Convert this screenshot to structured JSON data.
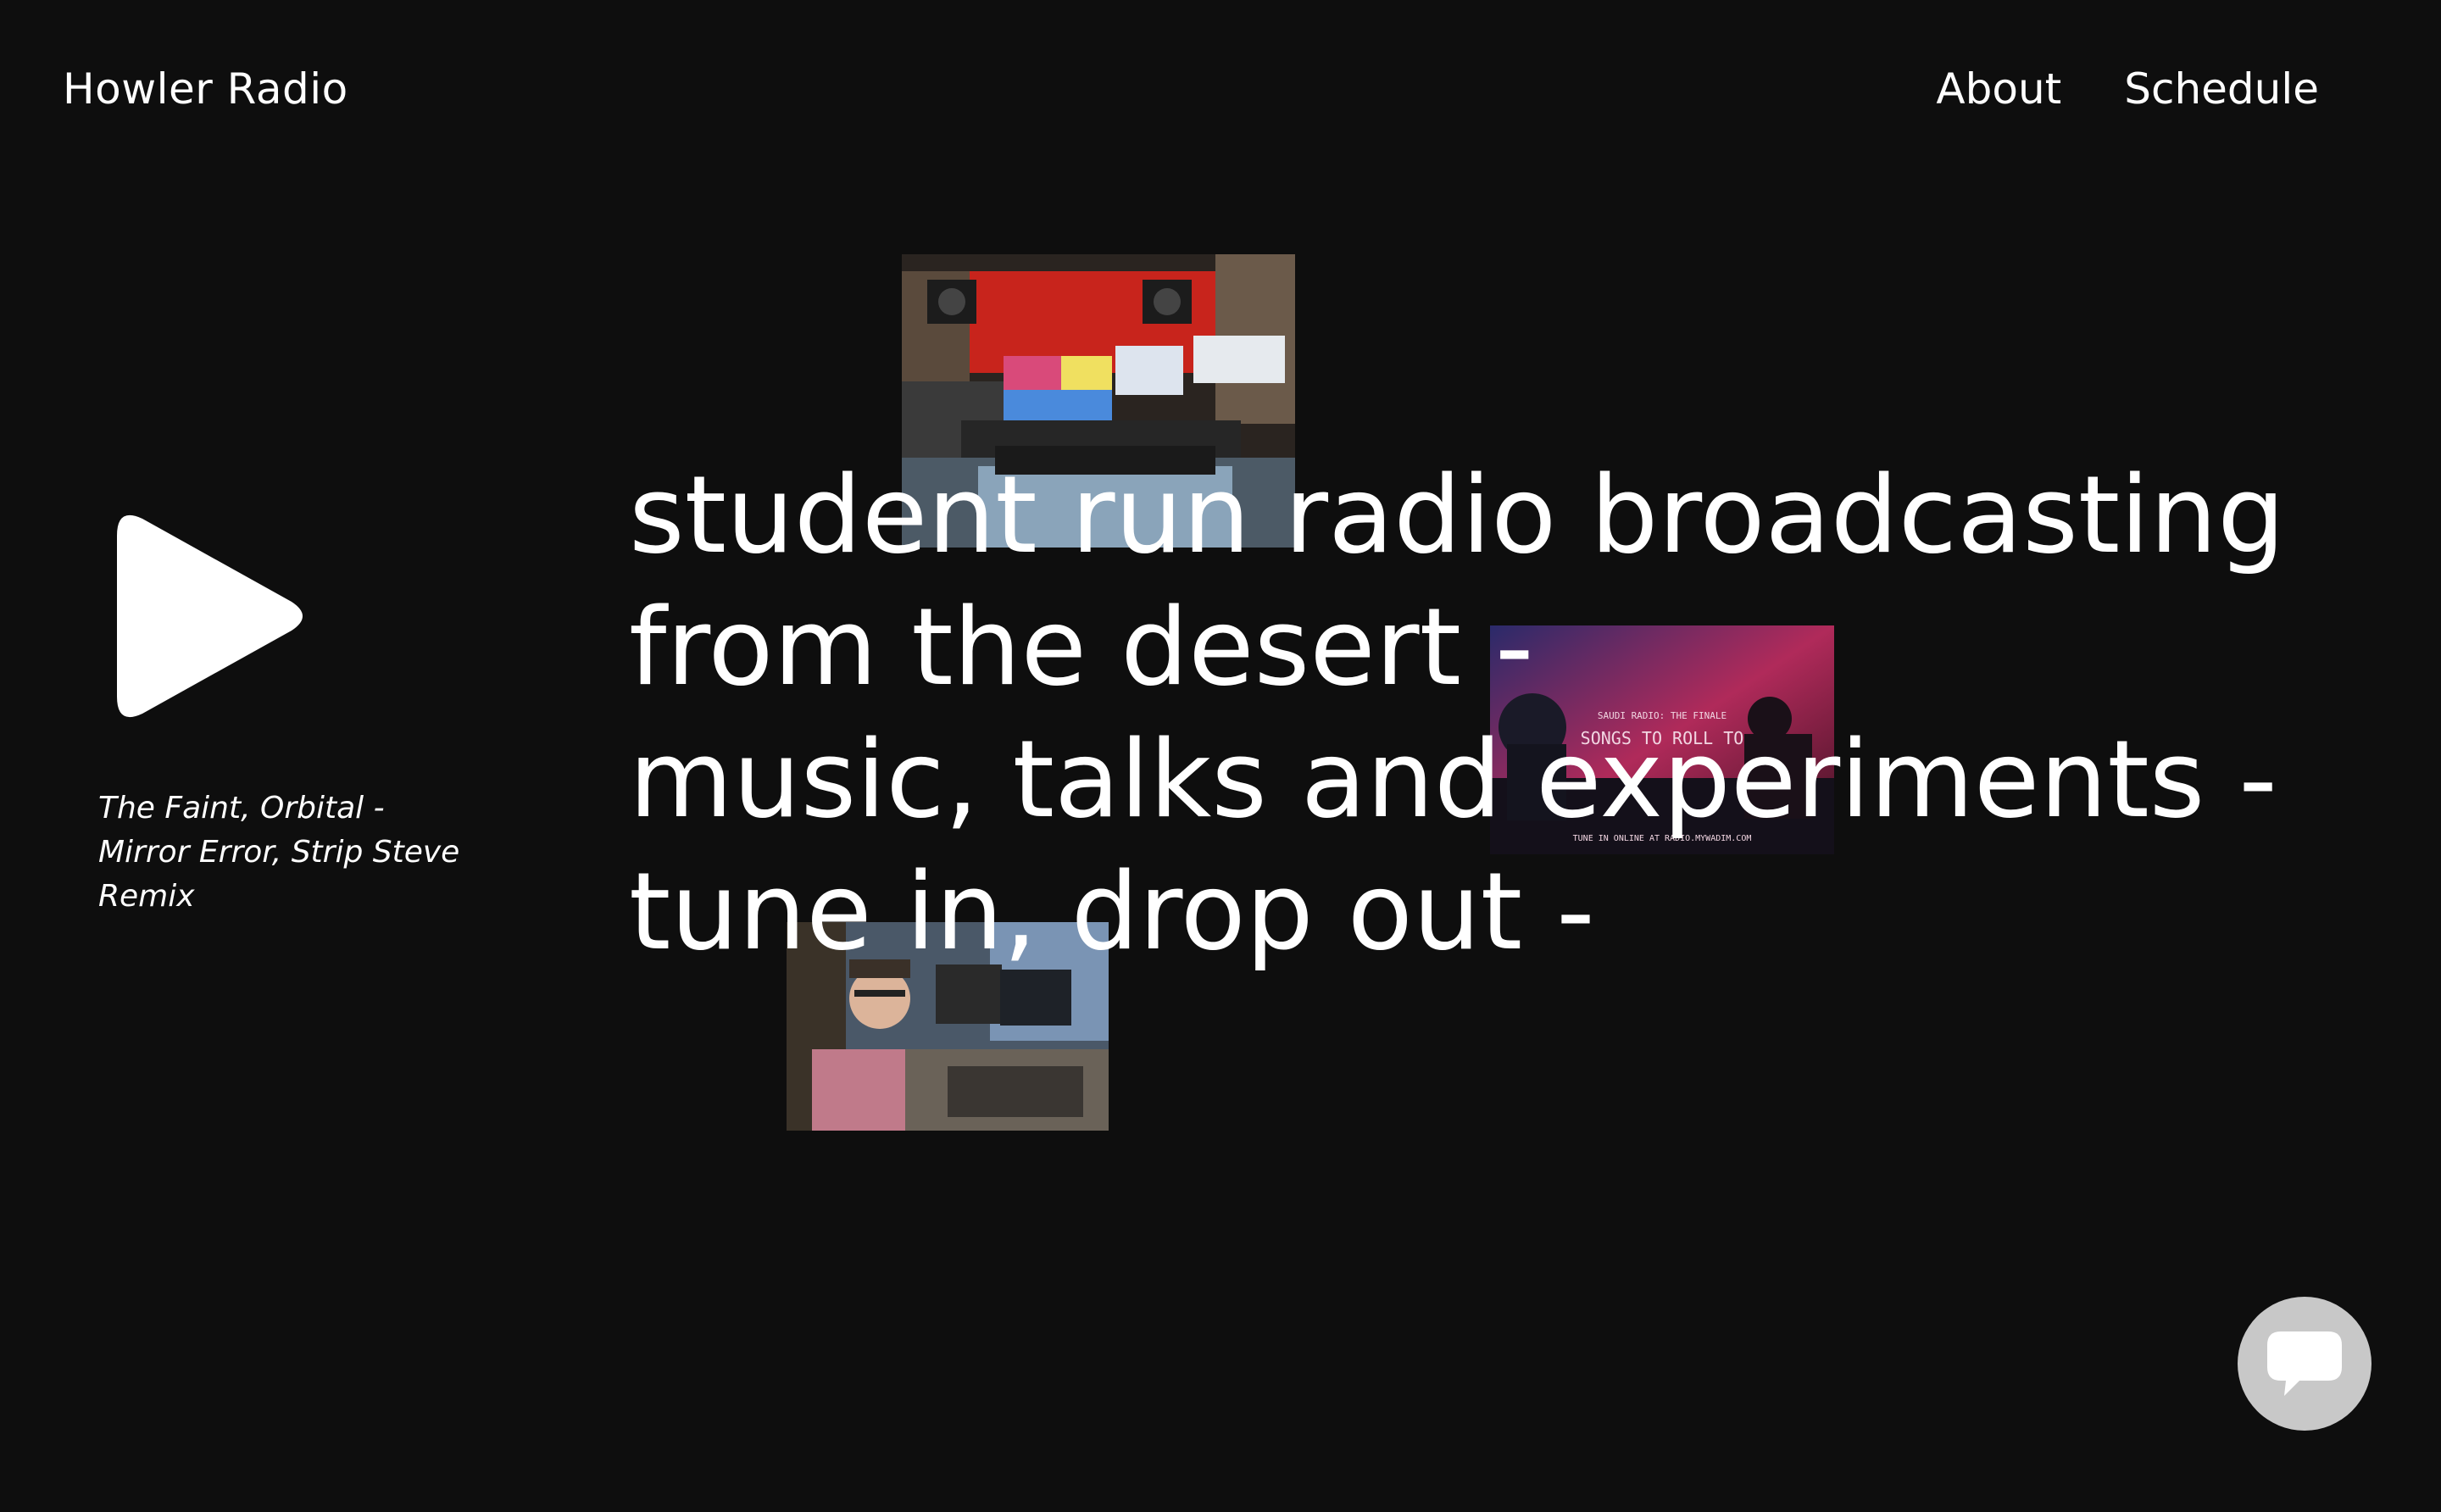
{
  "header": {
    "brand": "Howler Radio",
    "nav": [
      {
        "label": "About"
      },
      {
        "label": "Schedule"
      }
    ]
  },
  "player": {
    "play_icon": "play-icon",
    "now_playing": "The Faint, Orbital - Mirror Error, Strip Steve Remix"
  },
  "hero": {
    "lines": [
      "student run radio broadcasting",
      "from the desert -",
      "music, talks and experiments -",
      "tune in, drop out -"
    ]
  },
  "photos": {
    "poster": {
      "line1": "SAUDI RADIO: THE FINALE",
      "line2": "SONGS TO ROLL TO",
      "line3": "TUNE IN ONLINE AT RADIO.MYWADIM.COM"
    }
  },
  "chat": {
    "icon": "chat-bubble-icon"
  },
  "colors": {
    "background": "#0e0e0e",
    "text": "#ffffff",
    "chat_button": "#c8c8c8"
  }
}
